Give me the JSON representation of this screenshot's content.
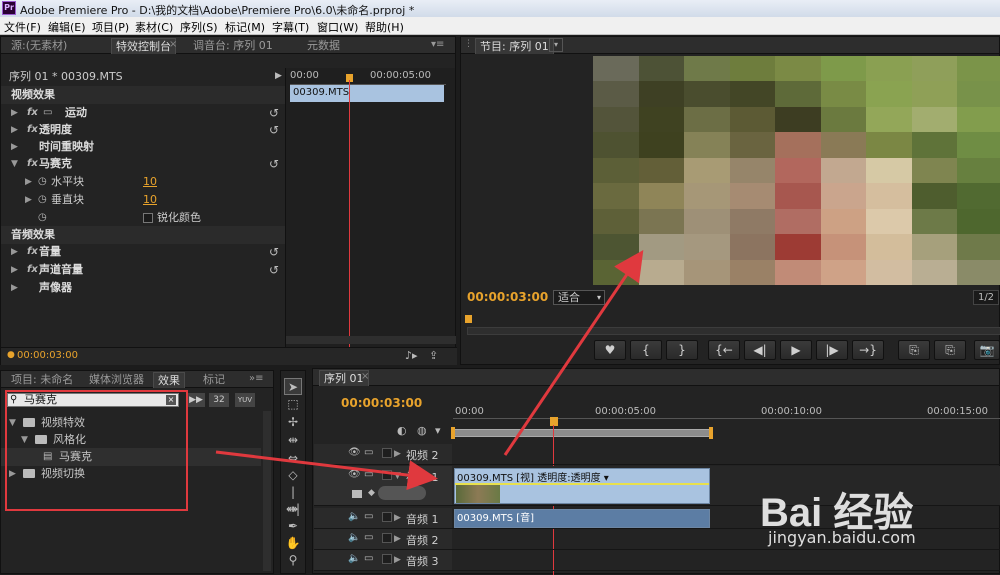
{
  "app": {
    "title": "Adobe Premiere Pro - D:\\我的文档\\Adobe\\Premiere Pro\\6.0\\未命名.prproj *",
    "icon_text": "Pr"
  },
  "menu": [
    "文件(F)",
    "编辑(E)",
    "项目(P)",
    "素材(C)",
    "序列(S)",
    "标记(M)",
    "字幕(T)",
    "窗口(W)",
    "帮助(H)"
  ],
  "top_left_tabs": [
    "源:(无素材)",
    "特效控制台",
    "调音台: 序列 01",
    "元数据"
  ],
  "effect_controls": {
    "clip_label": "序列 01 * 00309.MTS",
    "ruler_start": "00:00",
    "ruler_mid": "00:00:05:00",
    "clip_bar": "00309.MTS",
    "video_section": "视频效果",
    "items": {
      "motion": "运动",
      "opacity": "透明度",
      "time_remap": "时间重映射",
      "mosaic": "马赛克",
      "horizontal": "水平块",
      "horizontal_val": "10",
      "vertical": "垂直块",
      "vertical_val": "10",
      "sharpen": "锐化颜色"
    },
    "audio_section": "音频效果",
    "audio_items": {
      "volume": "音量",
      "channel": "声道音量",
      "panner": "声像器"
    },
    "timecode": "00:00:03:00"
  },
  "program": {
    "tab": "节目: 序列 01",
    "timecode": "00:00:03:00",
    "fit": "适合",
    "fraction": "1/2"
  },
  "transport": [
    "♥",
    "{",
    "}",
    "{←",
    "◀|",
    "▶",
    "|▶",
    "→}",
    "⎘",
    "⎘",
    "📷"
  ],
  "project_tabs": [
    "项目: 未命名",
    "媒体浏览器",
    "效果",
    "标记"
  ],
  "effects_panel": {
    "search": "马赛克",
    "badge1": "32",
    "badge2": "YUV",
    "tree": [
      "视频特效",
      "风格化",
      "马赛克",
      "视频切换"
    ]
  },
  "timeline": {
    "tab": "序列 01",
    "timecode": "00:00:03:00",
    "ruler": [
      "00:00",
      "00:00:05:00",
      "00:00:10:00",
      "00:00:15:00"
    ],
    "tracks": [
      "视频 2",
      "视频 1",
      "音频 1",
      "音频 2",
      "音频 3"
    ],
    "video_clip": "00309.MTS [视] 透明度:透明度 ▾",
    "audio_clip": "00309.MTS [音]"
  },
  "watermark": {
    "logo": "Bai 经验",
    "url": "jingyan.baidu.com"
  },
  "mosaic_colors": [
    [
      "#6a6a5a",
      "#4d5236",
      "#6f7a49",
      "#6e7d3d",
      "#7b8a45",
      "#7e9a4a",
      "#8aa052",
      "#8f9f5a",
      "#7b9449"
    ],
    [
      "#5b5b46",
      "#3e4024",
      "#4a4d2e",
      "#434626",
      "#5e6a39",
      "#798b45",
      "#8aa351",
      "#8fa057",
      "#78924a"
    ],
    [
      "#53543a",
      "#3f4221",
      "#6c6e45",
      "#5c5a34",
      "#3d3d22",
      "#6b7a3f",
      "#93a759",
      "#a2ad6f",
      "#829d4d"
    ],
    [
      "#4e5231",
      "#3e411f",
      "#858257",
      "#6a6440",
      "#a5705c",
      "#8a7a56",
      "#7b8744",
      "#5f7339",
      "#6f8d44"
    ],
    [
      "#5c5f37",
      "#635f38",
      "#a89b74",
      "#96856a",
      "#b2675d",
      "#c2a890",
      "#d6c9a5",
      "#7f8550",
      "#67803f"
    ],
    [
      "#6a6a3f",
      "#8f8558",
      "#a69777",
      "#a68b72",
      "#a7574f",
      "#caa58d",
      "#d5be9e",
      "#4e5d2e",
      "#516a31"
    ],
    [
      "#5e6038",
      "#7b7552",
      "#9e9077",
      "#8f7a65",
      "#b06d63",
      "#cda184",
      "#dcc9aa",
      "#6d7a48",
      "#4e672e"
    ],
    [
      "#4d5532",
      "#a29a82",
      "#a5987f",
      "#8c7460",
      "#9d3b34",
      "#c69279",
      "#d3bd9b",
      "#a6a07c",
      "#6f7a4a"
    ],
    [
      "#5a6434",
      "#b8ab8f",
      "#a69579",
      "#9a8166",
      "#c18b77",
      "#cfa287",
      "#d2bda1",
      "#b9ae93",
      "#8a8b68"
    ]
  ]
}
